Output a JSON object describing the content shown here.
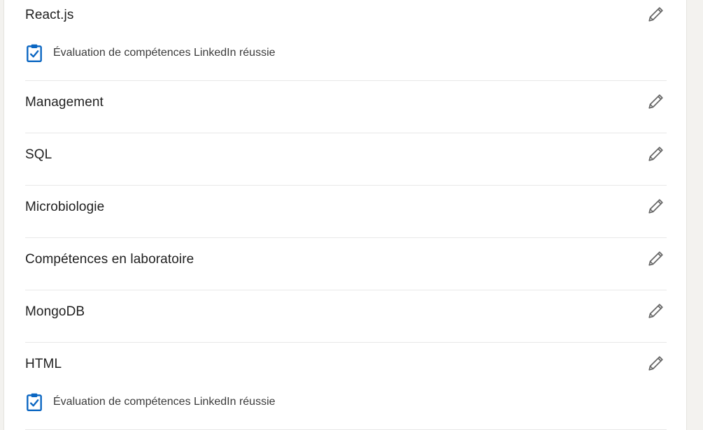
{
  "colors": {
    "background": "#f3f2ef",
    "card": "#ffffff",
    "divider": "#e8e8e8",
    "accent_blue": "#0a66c2",
    "pencil": "#666666",
    "text": "#1f1f1f"
  },
  "icons": {
    "edit": "pencil-icon",
    "assessment": "clipboard-check-icon"
  },
  "skills": [
    {
      "name": "React.js",
      "assessment": "Évaluation de compétences LinkedIn réussie",
      "edit_label": "Modifier"
    },
    {
      "name": "Management",
      "edit_label": "Modifier"
    },
    {
      "name": "SQL",
      "edit_label": "Modifier"
    },
    {
      "name": "Microbiologie",
      "edit_label": "Modifier"
    },
    {
      "name": "Compétences en laboratoire",
      "edit_label": "Modifier"
    },
    {
      "name": "MongoDB",
      "edit_label": "Modifier"
    },
    {
      "name": "HTML",
      "assessment": "Évaluation de compétences LinkedIn réussie",
      "edit_label": "Modifier"
    }
  ]
}
